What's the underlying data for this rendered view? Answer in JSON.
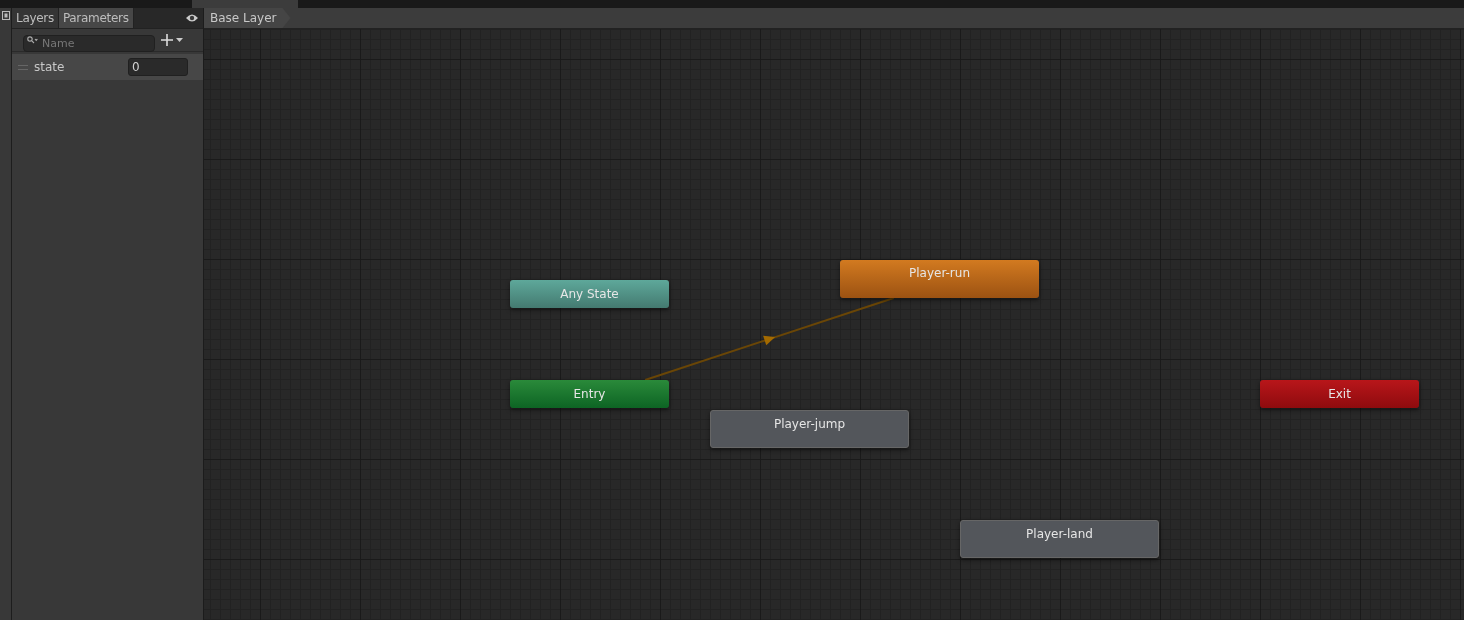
{
  "left_panel": {
    "tabs": [
      {
        "label": "Layers",
        "selected": false
      },
      {
        "label": "Parameters",
        "selected": true
      }
    ],
    "search": {
      "placeholder": "Name"
    },
    "parameters": [
      {
        "name": "state",
        "value": "0"
      }
    ]
  },
  "breadcrumb": "Base Layer",
  "graph": {
    "nodes": [
      {
        "name": "Any State",
        "kind": "any"
      },
      {
        "name": "Player-run",
        "kind": "default"
      },
      {
        "name": "Entry",
        "kind": "entry"
      },
      {
        "name": "Player-jump",
        "kind": "state"
      },
      {
        "name": "Exit",
        "kind": "exit"
      },
      {
        "name": "Player-land",
        "kind": "state"
      }
    ],
    "transitions": [
      {
        "kind": "arrow"
      }
    ]
  }
}
